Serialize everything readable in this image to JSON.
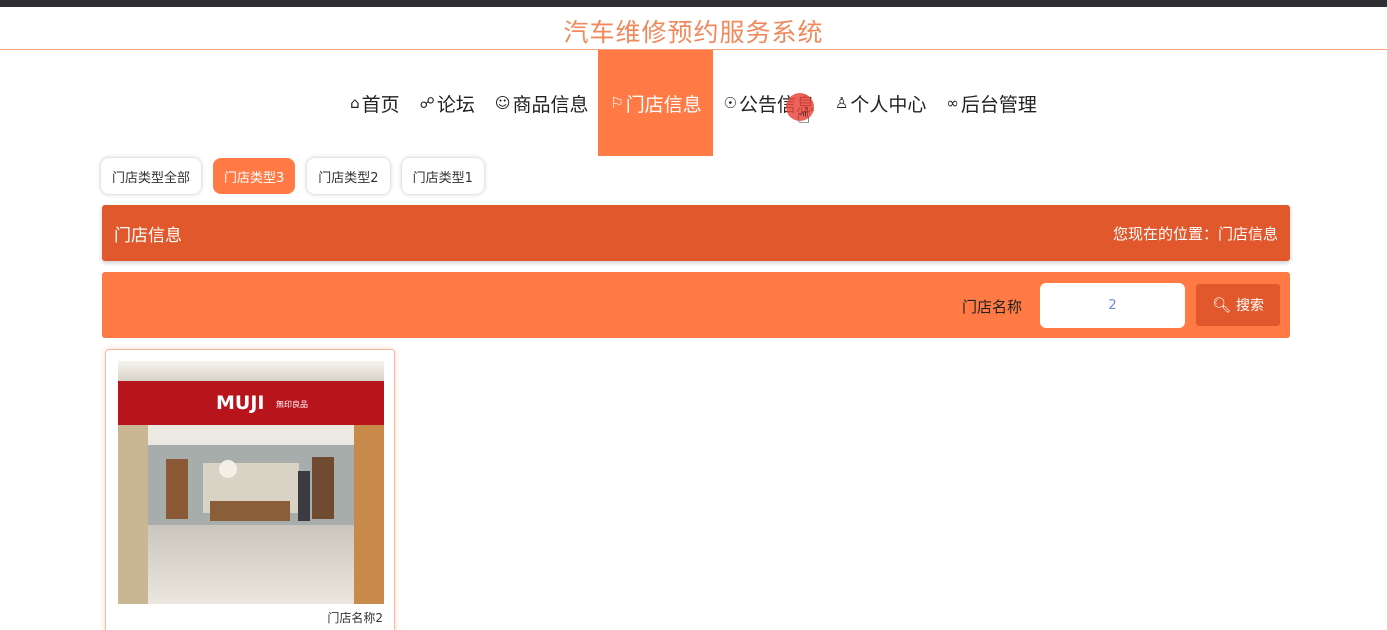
{
  "site": {
    "title": "汽车维修预约服务系统"
  },
  "nav": {
    "items": [
      {
        "icon": "home-icon",
        "glyph": "⌂",
        "label": "首页"
      },
      {
        "icon": "chat-icon",
        "glyph": "☍",
        "label": "论坛"
      },
      {
        "icon": "product-icon",
        "glyph": "☺",
        "label": "商品信息"
      },
      {
        "icon": "flag-icon",
        "glyph": "⚐",
        "label": "门店信息"
      },
      {
        "icon": "notice-icon",
        "glyph": "☉",
        "label": "公告信息"
      },
      {
        "icon": "user-icon",
        "glyph": "♙",
        "label": "个人中心"
      },
      {
        "icon": "link-icon",
        "glyph": "∞",
        "label": "后台管理"
      }
    ],
    "active_index": 3
  },
  "categories": {
    "items": [
      "门店类型全部",
      "门店类型3",
      "门店类型2",
      "门店类型1"
    ],
    "active_index": 1
  },
  "section": {
    "title": "门店信息",
    "breadcrumb": "您现在的位置：门店信息"
  },
  "search": {
    "label": "门店名称",
    "value": "2",
    "button_label": "搜索"
  },
  "stores": [
    {
      "brand": "MUJI",
      "brand_sub": "無印良品",
      "name": "门店名称2"
    }
  ],
  "colors": {
    "accent": "#ff7a45",
    "accent_dark": "#e0582b",
    "title": "#f08a5d"
  }
}
